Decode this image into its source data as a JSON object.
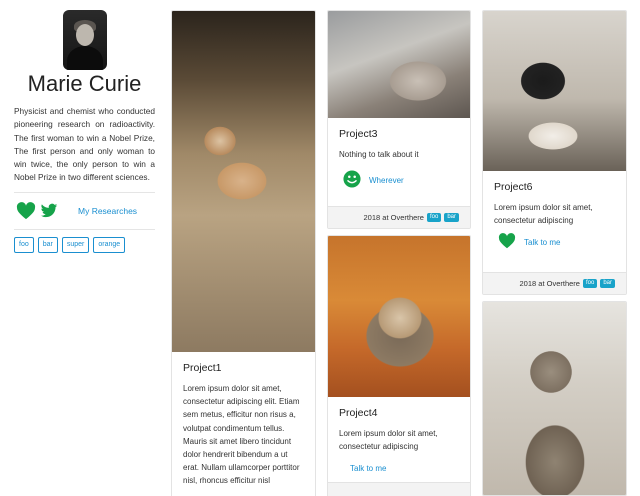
{
  "profile": {
    "name": "Marie Curie",
    "bio": "Physicist and chemist who conducted pioneering research on radioactivity. The first woman to win a Nobel Prize, The first person and only woman to win twice, the only person to win a Nobel Prize in two different sciences.",
    "research_link": "My Researches",
    "tags": [
      "foo",
      "bar",
      "super",
      "orange"
    ]
  },
  "cards": {
    "project1": {
      "title": "Project1",
      "text": "Lorem ipsum dolor sit amet, consectetur adipiscing elit. Etiam sem metus, efficitur non risus a, volutpat condimentum tellus. Mauris sit amet libero tincidunt dolor hendrerit bibendum a ut erat. Nullam ullamcorper porttitor nisl, rhoncus efficitur nisl"
    },
    "project3": {
      "title": "Project3",
      "text": "Nothing to talk about it",
      "action_label": "Wherever",
      "footer_text": "2018 at Overthere",
      "badges": [
        "foo",
        "bar"
      ]
    },
    "project4": {
      "title": "Project4",
      "text": "Lorem ipsum dolor sit amet, consectetur adipiscing",
      "action_label": "Talk to me"
    },
    "project6": {
      "title": "Project6",
      "text": "Lorem ipsum dolor sit amet, consectetur adipiscing",
      "action_label": "Talk to me",
      "footer_text": "2018 at Overthere",
      "badges": [
        "foo",
        "bar"
      ]
    }
  },
  "colors": {
    "accent": "#1a8fd0",
    "icon_green": "#16a34a",
    "badge": "#19a3c9"
  },
  "icons": [
    "heart-icon",
    "twitter-icon",
    "smiley-icon"
  ]
}
